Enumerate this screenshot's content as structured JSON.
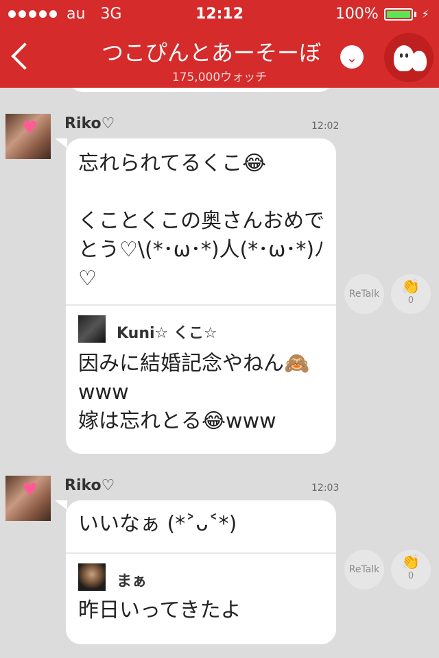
{
  "status_bar": {
    "carrier": "au",
    "network": "3G",
    "time": "12:12",
    "battery": "100%",
    "battery_level": 1.0
  },
  "nav": {
    "title": "つこぴんとあーそーぼ",
    "watchers": "175,000ウォッチ"
  },
  "messages": [
    {
      "user": "Riko♡",
      "time": "12:02",
      "text": "忘れられてるくこ😂\n\nくことくこの奥さんおめでとう♡\\(*･ω･*)人(*･ω･*)ﾉ♡",
      "quote": {
        "user": "Kuni☆ くこ☆",
        "text": "因みに結婚記念やねん🙈www\n嫁は忘れとる😂www"
      },
      "retalk_label": "ReTalk",
      "clap_count": "0"
    },
    {
      "user": "Riko♡",
      "time": "12:03",
      "text": "いいなぁ (*˃ᴗ˂*)",
      "quote": {
        "user": "まぁ",
        "text": "昨日いってきたよ"
      },
      "retalk_label": "ReTalk",
      "clap_count": "0"
    }
  ],
  "colors": {
    "brand_red": "#d52b2b",
    "background": "#dcdcdc"
  }
}
